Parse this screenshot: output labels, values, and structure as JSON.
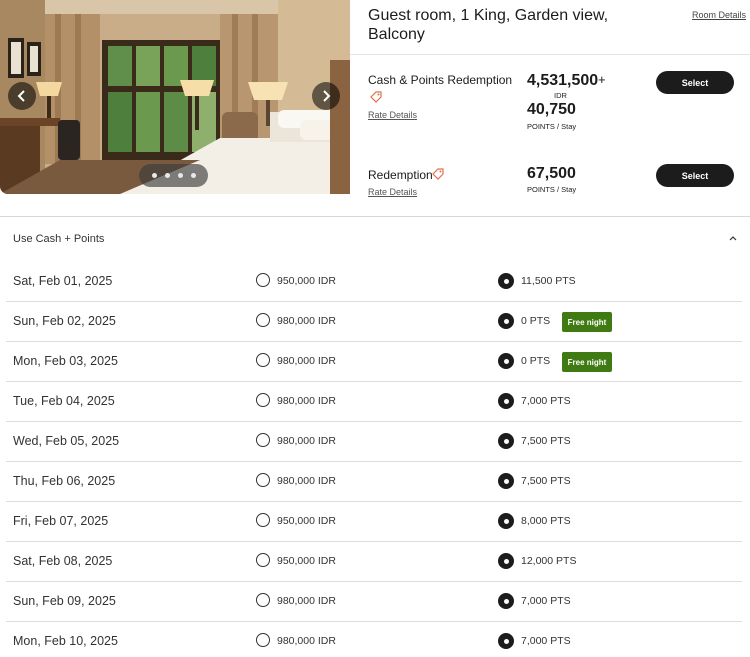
{
  "room": {
    "title": "Guest room, 1 King, Garden view, Balcony",
    "details_link": "Room Details",
    "image_alt": "hotel-room-photo"
  },
  "rates": [
    {
      "name": "Cash & Points Redemption",
      "rate_details": "Rate Details",
      "cash_amount": "4,531,500",
      "plus": "+",
      "currency": "IDR",
      "points": "40,750",
      "points_label": "POINTS / Stay",
      "select_label": "Select"
    },
    {
      "name": "Redemption",
      "rate_details": "Rate Details",
      "points": "67,500",
      "points_label": "POINTS / Stay",
      "select_label": "Select"
    }
  ],
  "cash_points": {
    "title": "Use Cash + Points",
    "rows": [
      {
        "date": "Sat, Feb 01, 2025",
        "cash": "950,000 IDR",
        "points": "11,500 PTS",
        "badge": ""
      },
      {
        "date": "Sun, Feb 02, 2025",
        "cash": "980,000 IDR",
        "points": "0 PTS",
        "badge": "Free night"
      },
      {
        "date": "Mon, Feb 03, 2025",
        "cash": "980,000 IDR",
        "points": "0 PTS",
        "badge": "Free night"
      },
      {
        "date": "Tue, Feb 04, 2025",
        "cash": "980,000 IDR",
        "points": "7,000 PTS",
        "badge": ""
      },
      {
        "date": "Wed, Feb 05, 2025",
        "cash": "980,000 IDR",
        "points": "7,500 PTS",
        "badge": ""
      },
      {
        "date": "Thu, Feb 06, 2025",
        "cash": "980,000 IDR",
        "points": "7,500 PTS",
        "badge": ""
      },
      {
        "date": "Fri, Feb 07, 2025",
        "cash": "950,000 IDR",
        "points": "8,000 PTS",
        "badge": ""
      },
      {
        "date": "Sat, Feb 08, 2025",
        "cash": "950,000 IDR",
        "points": "12,000 PTS",
        "badge": ""
      },
      {
        "date": "Sun, Feb 09, 2025",
        "cash": "980,000 IDR",
        "points": "7,000 PTS",
        "badge": ""
      },
      {
        "date": "Mon, Feb 10, 2025",
        "cash": "980,000 IDR",
        "points": "7,000 PTS",
        "badge": ""
      }
    ]
  },
  "colors": {
    "button_dark": "#1c1c1c",
    "free_badge": "#3f7a12",
    "tag_icon": "#e0704a"
  },
  "icons": {
    "prev": "chevron-left-icon",
    "next": "chevron-right-icon",
    "tag": "tag-icon",
    "collapse": "chevron-up-icon"
  }
}
